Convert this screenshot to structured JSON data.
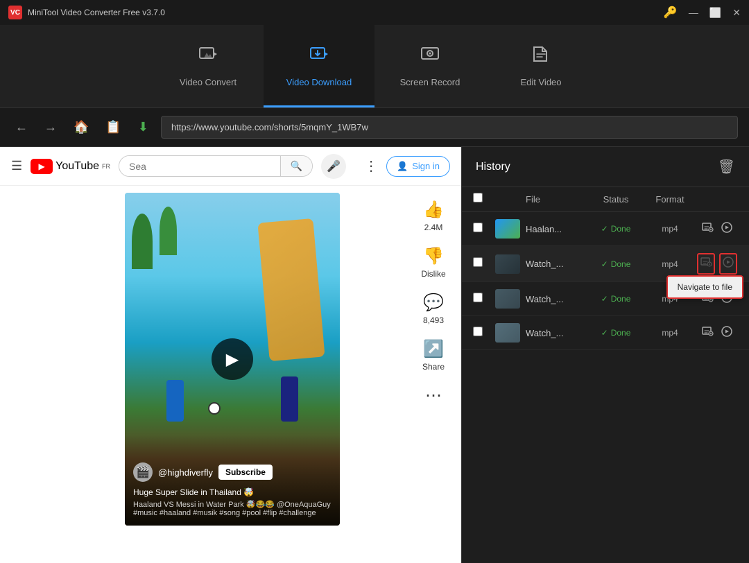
{
  "app": {
    "title": "MiniTool Video Converter Free v3.7.0",
    "icon": "VC"
  },
  "titlebar": {
    "key_icon": "🔑",
    "minimize": "—",
    "maximize": "⬜",
    "close": "✕"
  },
  "nav": {
    "tabs": [
      {
        "id": "video-convert",
        "label": "Video Convert",
        "icon": "⬛",
        "active": false
      },
      {
        "id": "video-download",
        "label": "Video Download",
        "icon": "⬛",
        "active": true
      },
      {
        "id": "screen-record",
        "label": "Screen Record",
        "icon": "⬛",
        "active": false
      },
      {
        "id": "edit-video",
        "label": "Edit Video",
        "icon": "⬛",
        "active": false
      }
    ]
  },
  "toolbar": {
    "back_label": "←",
    "forward_label": "→",
    "home_label": "🏠",
    "clipboard_label": "📋",
    "download_label": "⬇",
    "url": "https://www.youtube.com/shorts/5mqmY_1WB7w"
  },
  "youtube": {
    "logo_text": "YouTube",
    "logo_sup": "FR",
    "search_placeholder": "Sea",
    "search_icon": "🔍",
    "mic_icon": "🎤",
    "dots_icon": "⋮",
    "signin_icon": "👤",
    "signin_label": "Sign in",
    "menu_icon": "☰",
    "video": {
      "likes": "2.4M",
      "comments": "8,493",
      "share": "Share",
      "dislike": "Dislike",
      "channel": "@highdiverfly",
      "subscribe": "Subscribe",
      "title": "Huge Super Slide in Thailand 🤯",
      "tags": "Haaland VS Messi in Water Park 🤯😂😂\n@OneAquaGuy #music #haaland #musik\n#song #pool #flip #challenge"
    }
  },
  "history": {
    "title": "History",
    "delete_icon": "🗑",
    "columns": {
      "file": "File",
      "status": "Status",
      "format": "Format"
    },
    "items": [
      {
        "id": 1,
        "file": "Haalan...",
        "status": "Done",
        "format": "mp4",
        "highlighted": false
      },
      {
        "id": 2,
        "file": "Watch_...",
        "status": "Done",
        "format": "mp4",
        "highlighted": true
      },
      {
        "id": 3,
        "file": "Watch_...",
        "status": "Done",
        "format": "mp4",
        "highlighted": false
      },
      {
        "id": 4,
        "file": "Watch_...",
        "status": "Done",
        "format": "mp4",
        "highlighted": false
      }
    ],
    "navigate_to_file": "Navigate to file"
  }
}
